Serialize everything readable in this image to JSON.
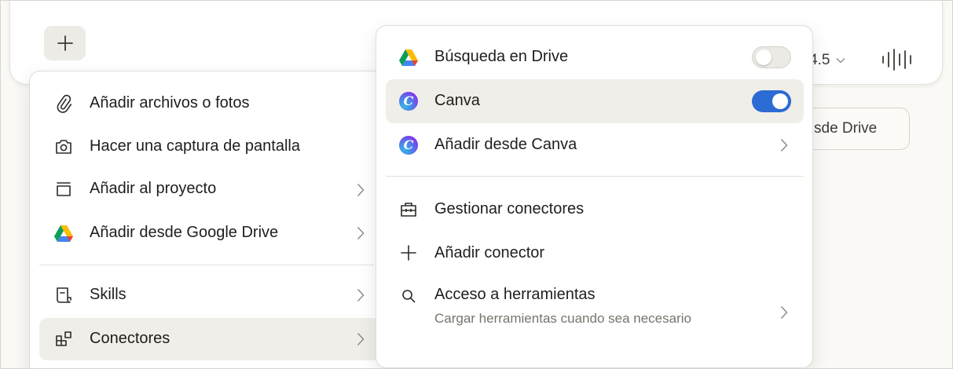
{
  "composer": {
    "model_tail": "4.5",
    "drive_chip_tail": "sde Drive"
  },
  "left_menu": {
    "items": [
      {
        "label": "Añadir archivos o fotos",
        "icon": "paperclip-icon"
      },
      {
        "label": "Hacer una captura de pantalla",
        "icon": "camera-icon"
      },
      {
        "label": "Añadir al proyecto",
        "icon": "project-box-icon"
      },
      {
        "label": "Añadir desde Google Drive",
        "icon": "google-drive-icon"
      },
      {
        "label": "Skills",
        "icon": "scroll-icon"
      },
      {
        "label": "Conectores",
        "icon": "connectors-icon"
      }
    ]
  },
  "right_menu": {
    "items": [
      {
        "label": "Búsqueda en Drive",
        "icon": "google-drive-icon",
        "toggle": false
      },
      {
        "label": "Canva",
        "icon": "canva-icon",
        "toggle": true
      },
      {
        "label": "Añadir desde Canva",
        "icon": "canva-icon"
      },
      {
        "label": "Gestionar conectores",
        "icon": "toolbox-icon"
      },
      {
        "label": "Añadir conector",
        "icon": "plus-icon"
      },
      {
        "label": "Acceso a herramientas",
        "sublabel": "Cargar herramientas cuando sea necesario",
        "icon": "search-icon"
      }
    ],
    "canva_glyph": "C"
  },
  "colors": {
    "toggle_on": "#2c6bd4",
    "highlight": "#f0eee8",
    "background": "#faf9f5"
  }
}
